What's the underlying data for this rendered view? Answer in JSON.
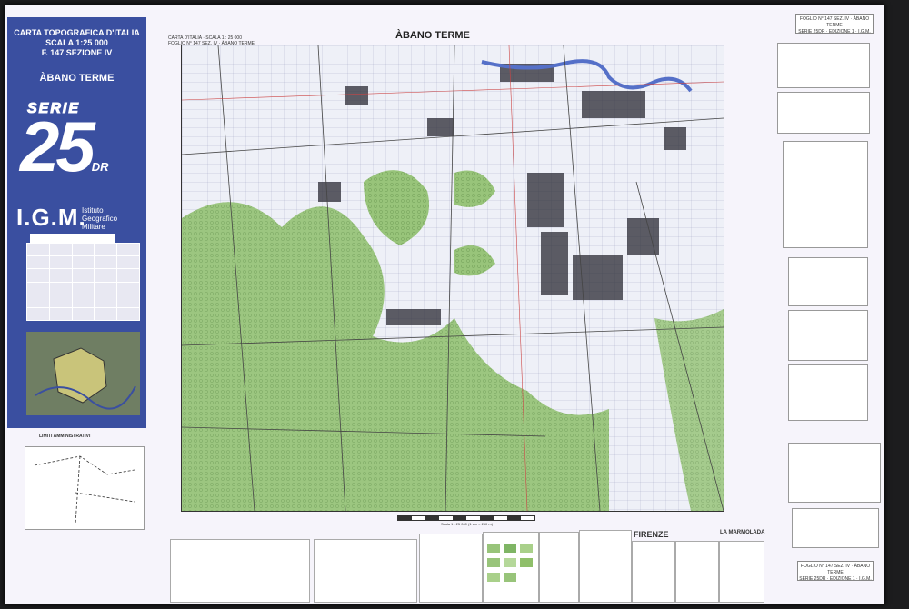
{
  "sheet": {
    "serie_label": "SERIE",
    "serie_number": "25",
    "serie_suffix": "DR",
    "igm_logo": "I.G.M.",
    "igm_name_line1": "Istituto",
    "igm_name_line2": "Geografico",
    "igm_name_line3": "Militare"
  },
  "cover": {
    "line1": "CARTA TOPOGRAFICA D'ITALIA",
    "line2": "SCALA 1:25 000",
    "line3": "F. 147 SEZIONE IV",
    "name": "ÀBANO TERME"
  },
  "map": {
    "title": "ÀBANO TERME",
    "subtitle_line1": "CARTA D'ITALIA · SCALA 1 : 25 000",
    "subtitle_line2": "FOGLIO N° 147 SEZ. IV · ÀBANO TERME",
    "scale_text": "Scala 1 : 25 000 (1 cm = 250 m)"
  },
  "right_panel": {
    "foglio_top_line1": "FOGLIO N° 147 SEZ. IV · ÀBANO TERME",
    "foglio_top_line2": "SERIE 25DR · EDIZIONE 1 · I.G.M.",
    "foglio_bottom_line1": "FOGLIO N° 147 SEZ. IV · ÀBANO TERME",
    "foglio_bottom_line2": "SERIE 25DR · EDIZIONE 1 · I.G.M."
  },
  "bottom": {
    "limiti": "LIMITI AMMINISTRATIVI",
    "firenze": "FIRENZE",
    "marmolada": "LA MARMOLADA"
  },
  "colors": {
    "band_blue": "#3a4fa0",
    "vegetation_green": "#8fbf6a",
    "water_blue": "#5570c8",
    "urban_dark": "#2a2a33"
  }
}
